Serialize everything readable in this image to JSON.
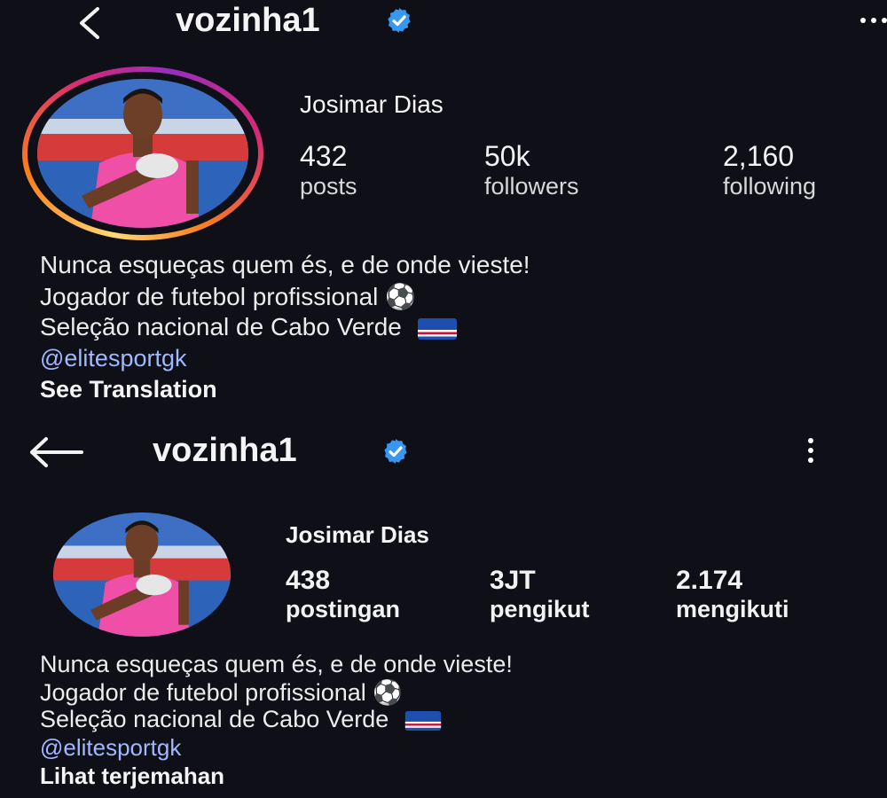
{
  "colors": {
    "background": "#0f0f17",
    "verified": "#3897f0",
    "link": "#9fb8ff",
    "story_ring": [
      "#feda75",
      "#fa7e1e",
      "#d62976",
      "#962fbf"
    ]
  },
  "top": {
    "username": "vozinha1",
    "back_icon": "chevron-left-icon",
    "menu_icon": "more-horizontal-icon",
    "display_name": "Josimar Dias",
    "stats": [
      {
        "value": "432",
        "label": "posts"
      },
      {
        "value": "50k",
        "label": "followers"
      },
      {
        "value": "2,160",
        "label": "following"
      }
    ],
    "bio": [
      "Nunca esqueças quem és, e de onde vieste!",
      "Jogador de futebol profissional ⚽",
      "Seleção nacional de Cabo Verde"
    ],
    "flag_icon": "cape-verde-flag-icon",
    "mention": "@elitesportgk",
    "translate_label": "See Translation"
  },
  "bottom": {
    "username": "vozinha1",
    "back_icon": "arrow-left-icon",
    "menu_icon": "more-vertical-icon",
    "display_name": "Josimar Dias",
    "stats": [
      {
        "value": "438",
        "label": "postingan"
      },
      {
        "value": "3JT",
        "label": "pengikut"
      },
      {
        "value": "2.174",
        "label": "mengikuti"
      }
    ],
    "bio": [
      "Nunca esqueças quem és, e de onde vieste!",
      "Jogador de futebol profissional ⚽",
      "Seleção nacional de Cabo Verde"
    ],
    "flag_icon": "cape-verde-flag-icon",
    "mention": "@elitesportgk",
    "translate_label": "Lihat terjemahan"
  }
}
